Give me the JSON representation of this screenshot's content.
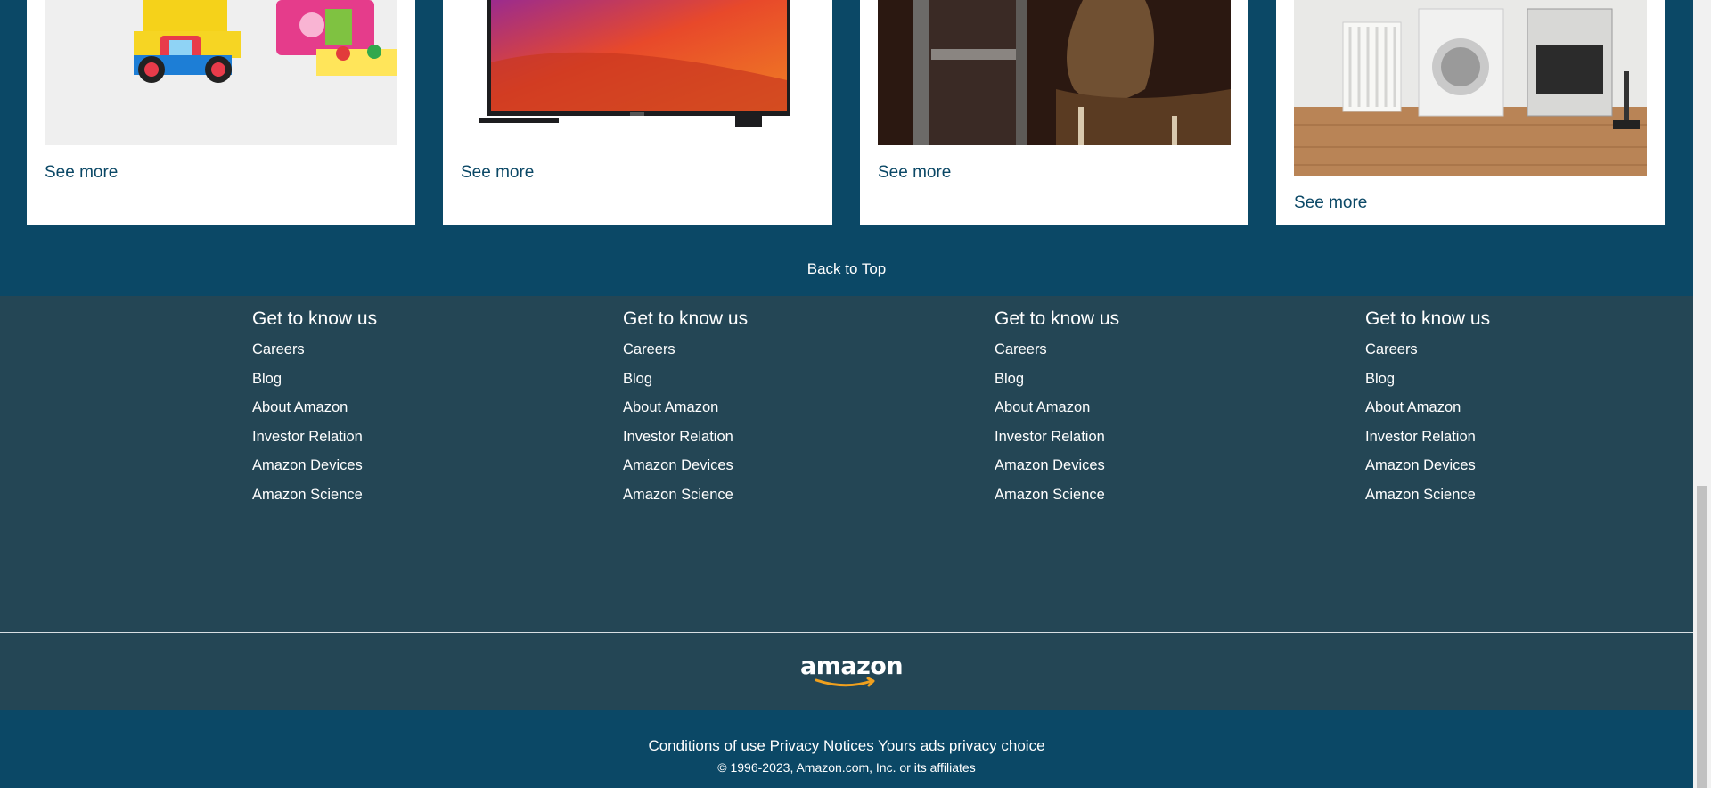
{
  "cards": [
    {
      "name": "toys",
      "see_more": "See more"
    },
    {
      "name": "tv",
      "see_more": "See more"
    },
    {
      "name": "furniture",
      "see_more": "See more"
    },
    {
      "name": "appliances",
      "see_more": "See more"
    }
  ],
  "back_to_top": "Back to Top",
  "footer": {
    "columns": [
      {
        "heading": "Get to know us",
        "links": [
          "Careers",
          "Blog",
          "About Amazon",
          "Investor Relation",
          "Amazon Devices",
          "Amazon Science"
        ]
      },
      {
        "heading": "Get to know us",
        "links": [
          "Careers",
          "Blog",
          "About Amazon",
          "Investor Relation",
          "Amazon Devices",
          "Amazon Science"
        ]
      },
      {
        "heading": "Get to know us",
        "links": [
          "Careers",
          "Blog",
          "About Amazon",
          "Investor Relation",
          "Amazon Devices",
          "Amazon Science"
        ]
      },
      {
        "heading": "Get to know us",
        "links": [
          "Careers",
          "Blog",
          "About Amazon",
          "Investor Relation",
          "Amazon Devices",
          "Amazon Science"
        ]
      }
    ],
    "logo_text": "amazon",
    "legal_links": [
      "Conditions of use",
      "Privacy Notices",
      "Yours ads privacy choice"
    ],
    "copyright": "© 1996-2023, Amazon.com, Inc. or its affiliates"
  },
  "colors": {
    "brand_blue": "#0b4866",
    "footer_bg": "#244655",
    "logo_smile": "#f0a01e"
  }
}
